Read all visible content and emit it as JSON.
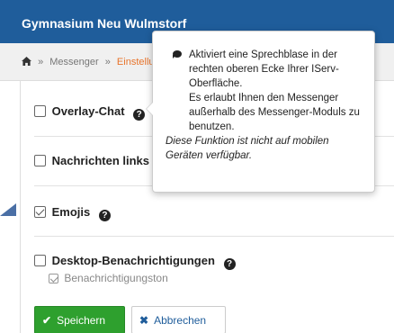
{
  "header": {
    "title": "Gymnasium Neu Wulmstorf"
  },
  "breadcrumb": {
    "items": [
      "Messenger",
      "Einstellu"
    ],
    "separator": "»"
  },
  "settings": {
    "overlay_chat": {
      "label": "Overlay-Chat",
      "checked": false
    },
    "messages_left": {
      "label": "Nachrichten links a",
      "checked": false
    },
    "emojis": {
      "label": "Emojis",
      "checked": true
    },
    "desktop_notifications": {
      "label": "Desktop-Benachrichtigungen",
      "checked": false
    },
    "notification_sound": {
      "label": "Benachrichtigungston",
      "checked": true,
      "disabled": true
    }
  },
  "buttons": {
    "save": {
      "label": "Speichern",
      "icon": "✔"
    },
    "cancel": {
      "label": "Abbrechen",
      "icon": "✖"
    }
  },
  "tooltip": {
    "main": "Aktiviert eine Sprechblase in der rechten oberen Ecke Ihrer IServ-Oberfläche.\nEs erlaubt Ihnen den Messenger außerhalb des Messenger-Moduls zu benutzen.",
    "note": "Diese Funktion ist nicht auf mobilen Geräten verfügbar."
  },
  "colors": {
    "header": "#1f5d9b",
    "breadcrumb_active": "#e8742b",
    "save_button": "#2ea02e",
    "cancel_text": "#1f5d9b"
  },
  "icons": {
    "home": "home-icon",
    "help": "question-circle-icon",
    "speech": "comment-icon"
  }
}
